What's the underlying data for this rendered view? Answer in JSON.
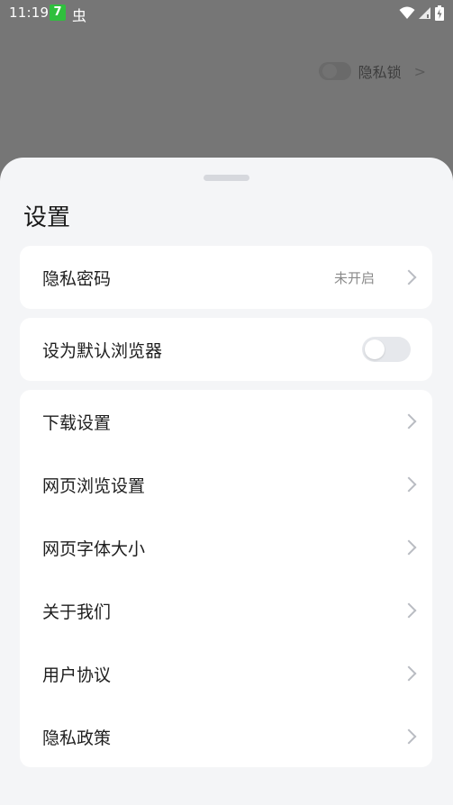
{
  "status_bar": {
    "time": "11:19",
    "badge": "7",
    "bug_glyph": "虫"
  },
  "background": {
    "privacy_lock_label": "隐私锁"
  },
  "sheet": {
    "title": "设置",
    "privacy_password": {
      "label": "隐私密码",
      "value": "未开启"
    },
    "default_browser": {
      "label": "设为默认浏览器",
      "enabled": false
    },
    "menu_items": [
      {
        "label": "下载设置"
      },
      {
        "label": "网页浏览设置"
      },
      {
        "label": "网页字体大小"
      },
      {
        "label": "关于我们"
      },
      {
        "label": "用户协议"
      },
      {
        "label": "隐私政策"
      }
    ]
  },
  "colors": {
    "overlay": "#767676",
    "sheet_bg": "#f4f5f7",
    "card_bg": "#ffffff",
    "status_badge": "#2fbf3d"
  },
  "icons": [
    "wifi-icon",
    "cell-signal-icon",
    "battery-icon",
    "chevron-right-icon"
  ]
}
